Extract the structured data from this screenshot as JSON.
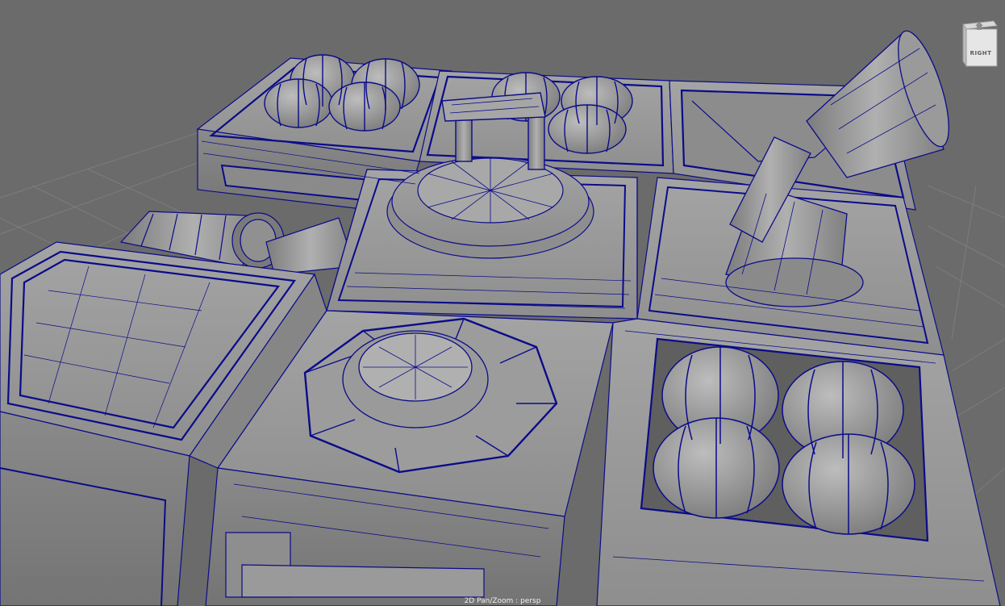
{
  "viewport": {
    "camera_name": "persp",
    "status_text": "2D Pan/Zoom : persp",
    "background_color": "#6b6b6b",
    "wireframe_color": "#0b0b8a",
    "shaded_color": "#9a9a9a",
    "grid_color": "#7b7b7b"
  },
  "viewcube": {
    "face_label": "RIGHT",
    "icon": "home-icon"
  }
}
